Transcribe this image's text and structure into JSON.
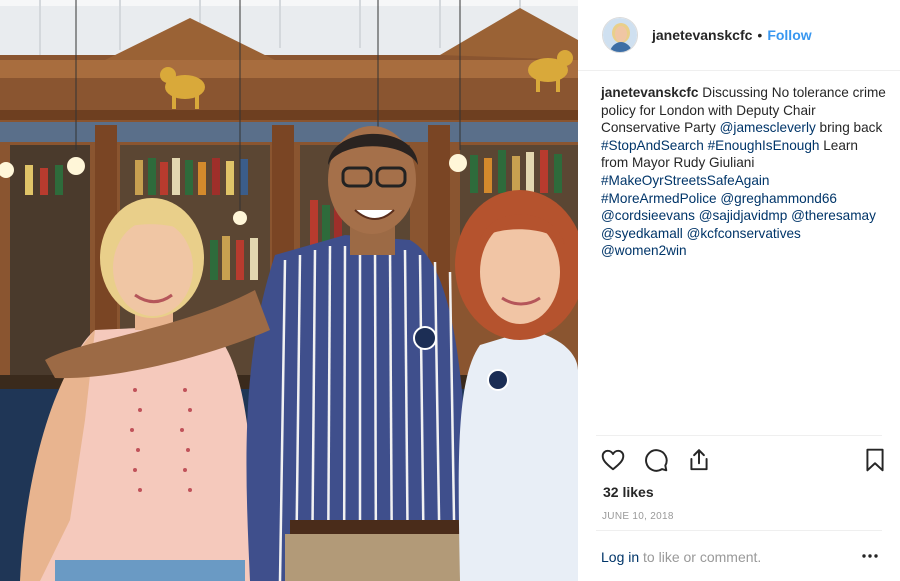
{
  "post": {
    "photo_alt": "Three people smiling in front of a pub bar",
    "author": "janetevanskcfc",
    "dot": "•",
    "follow_label": "Follow",
    "caption": {
      "username": "janetevanskcfc",
      "segments": [
        {
          "text": " Discussing No tolerance crime policy for London with Deputy Chair Conservative Party ",
          "link": false
        },
        {
          "text": "@jamescleverly",
          "link": true
        },
        {
          "text": " bring back ",
          "link": false
        },
        {
          "text": "#StopAndSearch",
          "link": true
        },
        {
          "text": " ",
          "link": false
        },
        {
          "text": "#EnoughIsEnough",
          "link": true
        },
        {
          "text": " Learn from Mayor Rudy Giuliani ",
          "link": false
        },
        {
          "text": "#MakeOyrStreetsSafeAgain",
          "link": true
        },
        {
          "text": " ",
          "link": false
        },
        {
          "text": "#MoreArmedPolice",
          "link": true
        },
        {
          "text": " ",
          "link": false
        },
        {
          "text": "@greghammond66",
          "link": true
        },
        {
          "text": " ",
          "link": false
        },
        {
          "text": "@cordsieevans",
          "link": true
        },
        {
          "text": " ",
          "link": false
        },
        {
          "text": "@sajidjavidmp",
          "link": true
        },
        {
          "text": " ",
          "link": false
        },
        {
          "text": "@theresamay",
          "link": true
        },
        {
          "text": " ",
          "link": false
        },
        {
          "text": "@syedkamall",
          "link": true
        },
        {
          "text": " ",
          "link": false
        },
        {
          "text": "@kcfconservatives",
          "link": true
        },
        {
          "text": " ",
          "link": false
        },
        {
          "text": "@women2win",
          "link": true
        }
      ]
    },
    "actions": {
      "like_icon": "heart-icon",
      "comment_icon": "comment-icon",
      "share_icon": "share-icon",
      "save_icon": "bookmark-icon"
    },
    "likes": "32 likes",
    "date": "JUNE 10, 2018",
    "login": {
      "link_label": "Log in",
      "rest": " to like or comment."
    },
    "more_icon": "more-options-icon"
  },
  "colors": {
    "link_blue": "#003569",
    "follow_blue": "#3897f0",
    "muted": "#999999",
    "text": "#262626"
  }
}
